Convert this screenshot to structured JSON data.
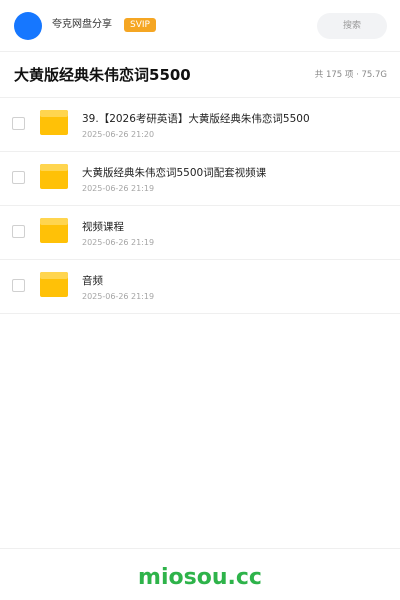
{
  "header": {
    "user_name": "夸克网盘分享",
    "badge": "SVIP",
    "search_placeholder": "搜索",
    "accent_color": "#1677ff"
  },
  "title": {
    "text": "大黄版经典朱伟恋词5500",
    "summary": "共 175 项 · 75.7G"
  },
  "files": [
    {
      "name": "39.【2026考研英语】大黄版经典朱伟恋词5500",
      "date": "2025-06-26 21:20",
      "icon": "folder-icon"
    },
    {
      "name": "大黄版经典朱伟恋词5500词配套视频课",
      "date": "2025-06-26 21:19",
      "icon": "folder-icon"
    },
    {
      "name": "视频课程",
      "date": "2025-06-26 21:19",
      "icon": "folder-icon"
    },
    {
      "name": "音频",
      "date": "2025-06-26 21:19",
      "icon": "folder-icon"
    }
  ],
  "footer": {
    "brand": "miosou.cc",
    "brand_color": "#2eb34a"
  }
}
